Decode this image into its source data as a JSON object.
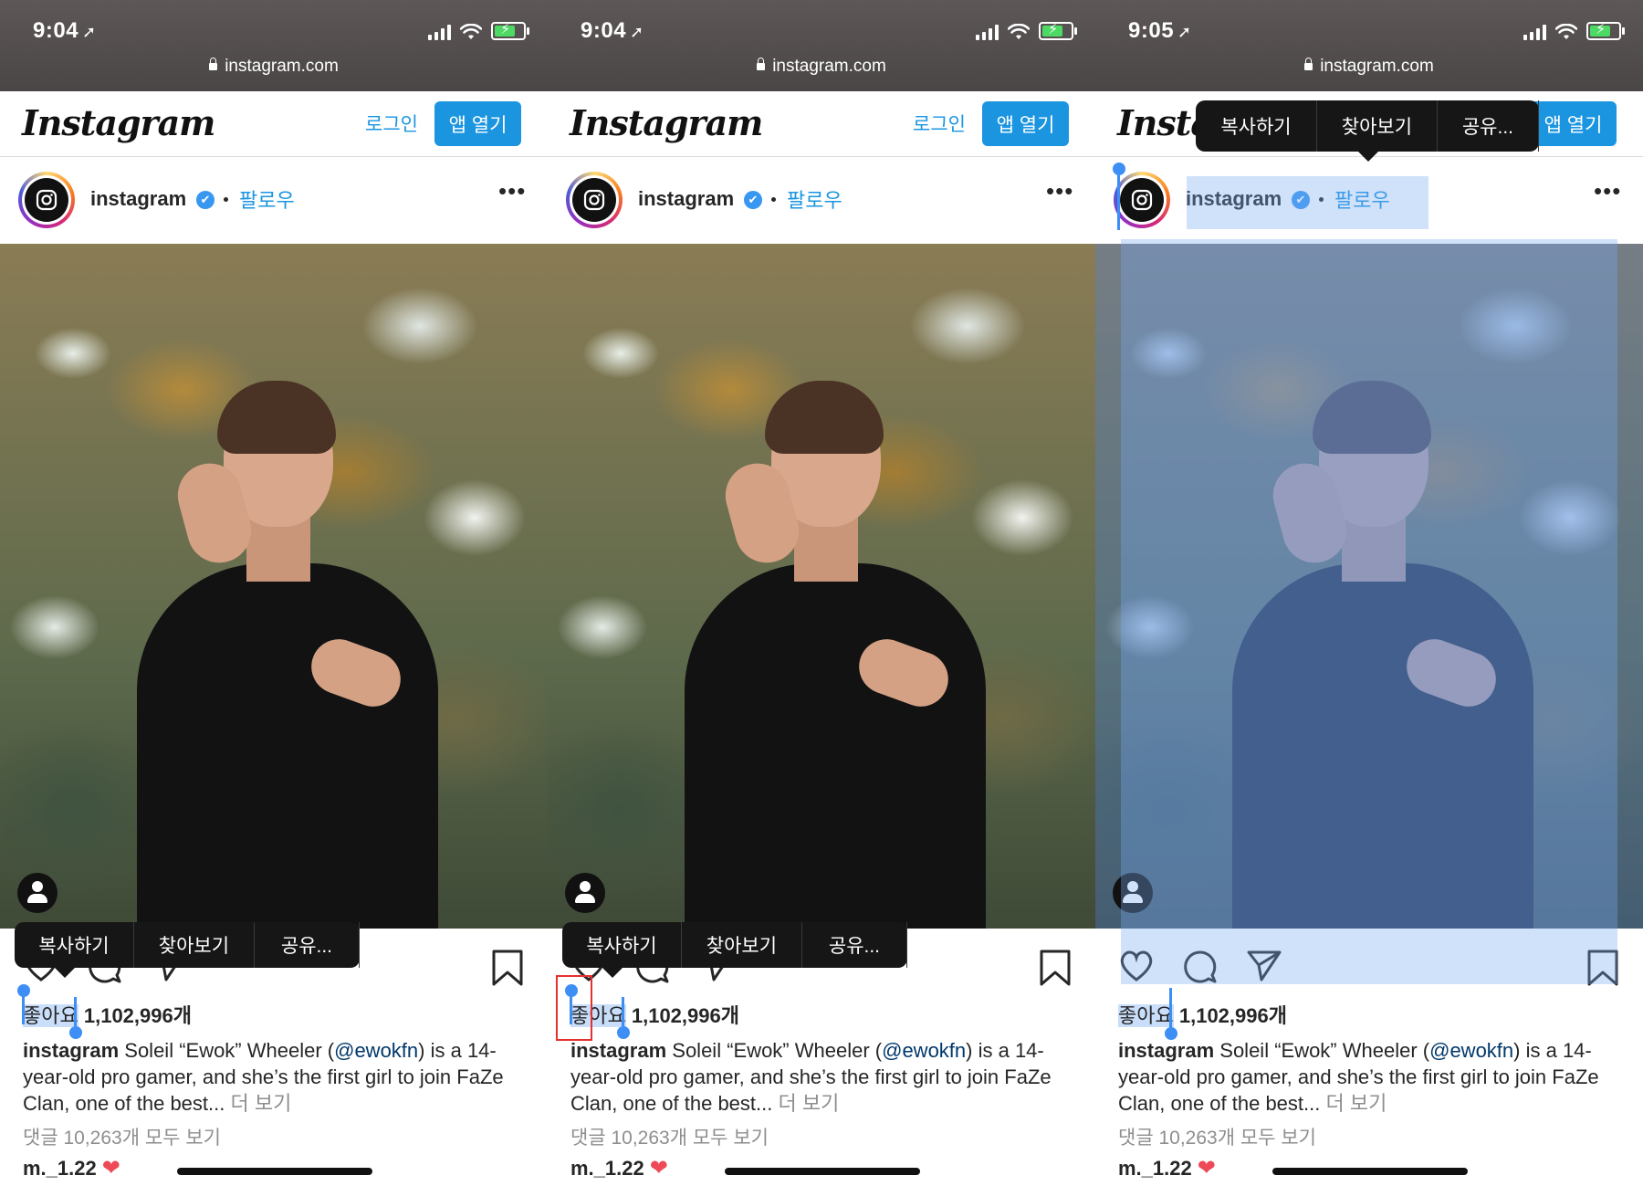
{
  "status": {
    "panels": [
      {
        "time": "9:04"
      },
      {
        "time": "9:04"
      },
      {
        "time": "9:05"
      }
    ]
  },
  "browser": {
    "url": "instagram.com"
  },
  "nav": {
    "logo": "Instagram",
    "login": "로그인",
    "open_app": "앱 열기"
  },
  "post": {
    "username": "instagram",
    "verified": "✔",
    "follow": "팔로우",
    "more": "•••",
    "likes_label": "좋아요",
    "likes_count": "1,102,996개",
    "caption_user": "instagram",
    "caption_a": " Soleil “Ewok” Wheeler (",
    "caption_mention": "@ewokfn",
    "caption_b": ") is a 14-year-old pro gamer, and she’s the first girl to join FaZe Clan, one of the best... ",
    "caption_more": "더 보기",
    "comments": "댓글 10,263개 모두 보기",
    "commenter": "m._1.22",
    "heart": "❤"
  },
  "menu": {
    "copy": "복사하기",
    "lookup": "찾아보기",
    "share": "공유..."
  },
  "colors": {
    "accent": "#1b95e0",
    "selection": "#3d8ef5",
    "highlight": "#e53030"
  },
  "icons": [
    "location-arrow-icon",
    "signal-icon",
    "wifi-icon",
    "battery-icon",
    "lock-icon",
    "verified-badge-icon",
    "more-icon",
    "user-tag-icon",
    "heart-icon",
    "comment-icon",
    "send-icon",
    "bookmark-icon"
  ]
}
